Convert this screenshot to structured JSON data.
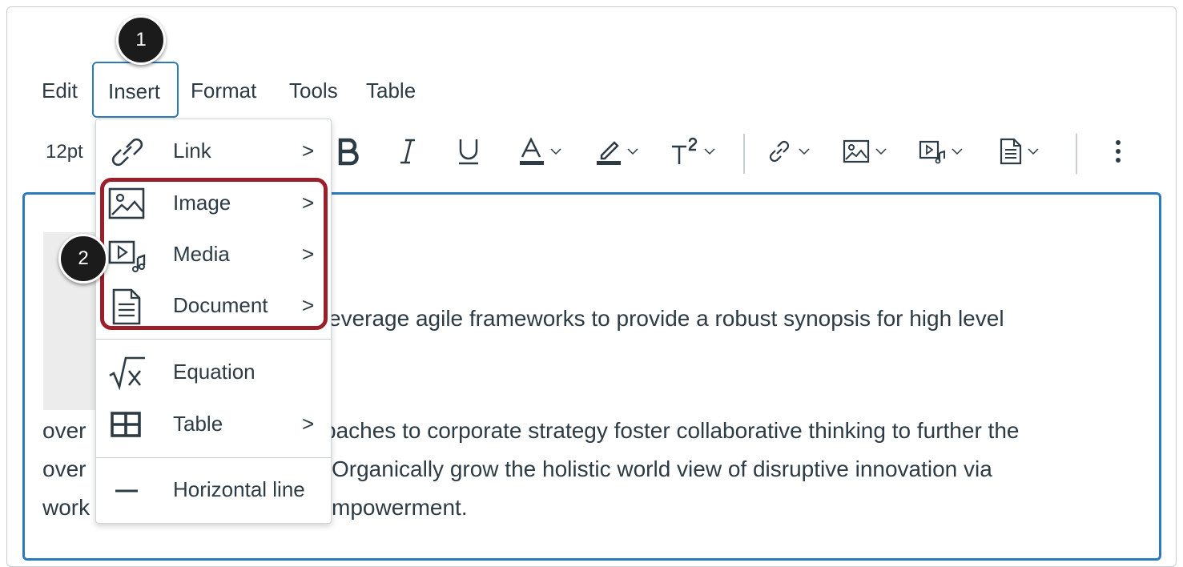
{
  "menubar": {
    "edit": "Edit",
    "insert": "Insert",
    "format": "Format",
    "tools": "Tools",
    "table": "Table"
  },
  "toolbar": {
    "font_size": "12pt",
    "icons": [
      "bold-icon",
      "italic-icon",
      "underline-icon",
      "text-color-icon",
      "highlight-color-icon",
      "superscript-icon",
      "link-icon",
      "image-icon",
      "media-icon",
      "document-icon",
      "more-icon"
    ]
  },
  "insert_menu": {
    "items": [
      {
        "label": "Link",
        "icon": "link-icon",
        "submenu": true
      },
      {
        "label": "Image",
        "icon": "image-icon",
        "submenu": true
      },
      {
        "label": "Media",
        "icon": "media-icon",
        "submenu": true
      },
      {
        "label": "Document",
        "icon": "document-icon",
        "submenu": true
      },
      {
        "label": "Equation",
        "icon": "equation-icon",
        "submenu": false
      },
      {
        "label": "Table",
        "icon": "table-icon",
        "submenu": true
      },
      {
        "label": "Horizontal line",
        "icon": "horizontal-line-icon",
        "submenu": false
      }
    ],
    "arrow": ">"
  },
  "editor": {
    "line1": "everage agile frameworks to provide a robust synopsis for high level",
    "line2_left": "over",
    "line2_right": "baches to corporate strategy foster collaborative thinking to further the",
    "line3_left": "over",
    "line3_right": "Organically grow the holistic world view of disruptive innovation via",
    "line4_left": "work",
    "line4_right": "mpowerment."
  },
  "callouts": {
    "one": "1",
    "two": "2"
  },
  "colors": {
    "accent": "#2b7abc",
    "highlight_box": "#9b1f29",
    "text": "#2d3b45"
  }
}
